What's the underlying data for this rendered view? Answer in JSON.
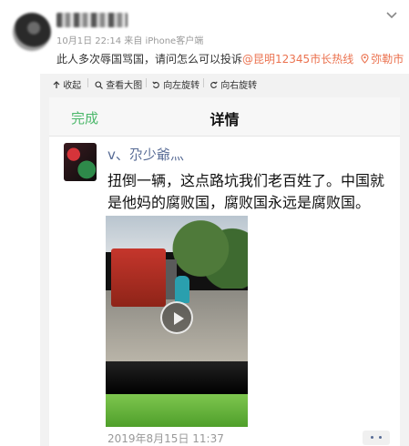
{
  "post": {
    "meta": "10月1日 22:14 来自 iPhone客户端",
    "text_prefix": "此人多次辱国骂国，请问怎么可以投诉",
    "link": "@昆明12345市长热线",
    "location": "弥勒市"
  },
  "toolbar": {
    "collapse": "收起",
    "view_large": "查看大图",
    "rotate_left": "向左旋转",
    "rotate_right": "向右旋转"
  },
  "screenshot": {
    "nav_done": "完成",
    "nav_title": "详情",
    "moment_name": "ⅴ、尕少爺灬",
    "moment_text": "扭倒一辆，这点路坑我们老百姓了。中国就是他妈的腐败国，腐败国永远是腐败国。",
    "timestamp": "2019年8月15日 11:37"
  },
  "colors": {
    "link": "#eb7350",
    "wechat_green": "#4cb86b",
    "wechat_name": "#576b95"
  },
  "icons": [
    "chevron-down-icon",
    "collapse-icon",
    "search-icon",
    "rotate-left-icon",
    "rotate-right-icon",
    "location-icon",
    "play-icon"
  ]
}
